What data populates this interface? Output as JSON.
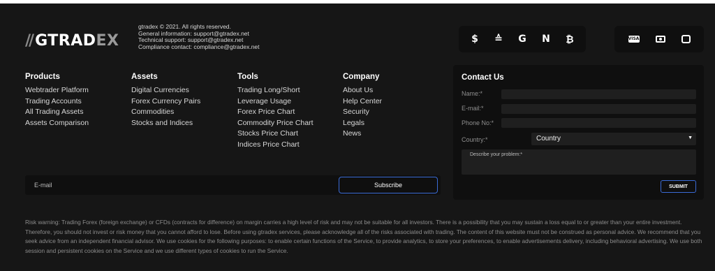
{
  "brand": {
    "slash": "//",
    "name_main": "GTRAD",
    "name_accent": "EX"
  },
  "company_info": {
    "line1": "gtradex  © 2021. All rights reserved.",
    "line2": "General information: support@gtradex.net",
    "line3": "Technical support: support@gtradex.net",
    "line4": "Compliance contact: compliance@gtradex.net"
  },
  "crypto_icons": [
    {
      "name": "coins-icon",
      "glyph": "$"
    },
    {
      "name": "ethereum-classic-icon",
      "glyph": "≙"
    },
    {
      "name": "g-coin-icon",
      "glyph": "G"
    },
    {
      "name": "chart-trend-icon",
      "glyph": "N"
    },
    {
      "name": "bitcoin-icon",
      "glyph": "₿"
    }
  ],
  "payment_icons": [
    {
      "name": "visa-icon",
      "glyph": "VISA"
    },
    {
      "name": "cash-icon",
      "glyph": ""
    },
    {
      "name": "wallet-icon",
      "glyph": ""
    }
  ],
  "columns": {
    "products": {
      "title": "Products",
      "links": [
        "Webtrader Platform",
        "Trading Accounts",
        "All Trading Assets",
        "Assets Comparison"
      ]
    },
    "assets": {
      "title": "Assets",
      "links": [
        "Digital Currencies",
        "Forex Currency Pairs",
        "Commodities",
        "Stocks and Indices"
      ]
    },
    "tools": {
      "title": "Tools",
      "links": [
        "Trading Long/Short",
        "Leverage Usage",
        "Forex Price Chart",
        "Commodity Price Chart",
        "Stocks Price Chart",
        "Indices Price Chart"
      ]
    },
    "company": {
      "title": "Company",
      "links": [
        "About Us",
        "Help Center",
        "Security",
        "Legals",
        "News"
      ]
    }
  },
  "subscribe": {
    "placeholder": "E-mail",
    "button": "Subscribe"
  },
  "contact": {
    "title": "Contact Us",
    "name_label": "Name:*",
    "email_label": "E-mail:*",
    "phone_label": "Phone No:*",
    "country_label": "Country:*",
    "country_value": "Country",
    "problem_placeholder": "Describe your problem:*",
    "submit": "SUBMIT"
  },
  "risk_warning": "Risk warning: Trading Forex (foreign exchange) or CFDs (contracts for difference) on margin carries a high level of risk and may not be suitable for all investors. There is a possibility that you may sustain a loss equal to or greater than your entire investment. Therefore, you should not invest or risk money that you cannot afford to lose. Before using gtradex services, please acknowledge all of the risks associated with trading. The content of this website must not be construed as personal advice. We recommend that you seek advice from an independent financial advisor. We use cookies for the following purposes: to enable certain functions of the Service, to provide analytics, to store your preferences, to enable advertisements delivery, including behavioral advertising. We use both session and persistent cookies on the Service and we use different types of cookies to run the Service."
}
